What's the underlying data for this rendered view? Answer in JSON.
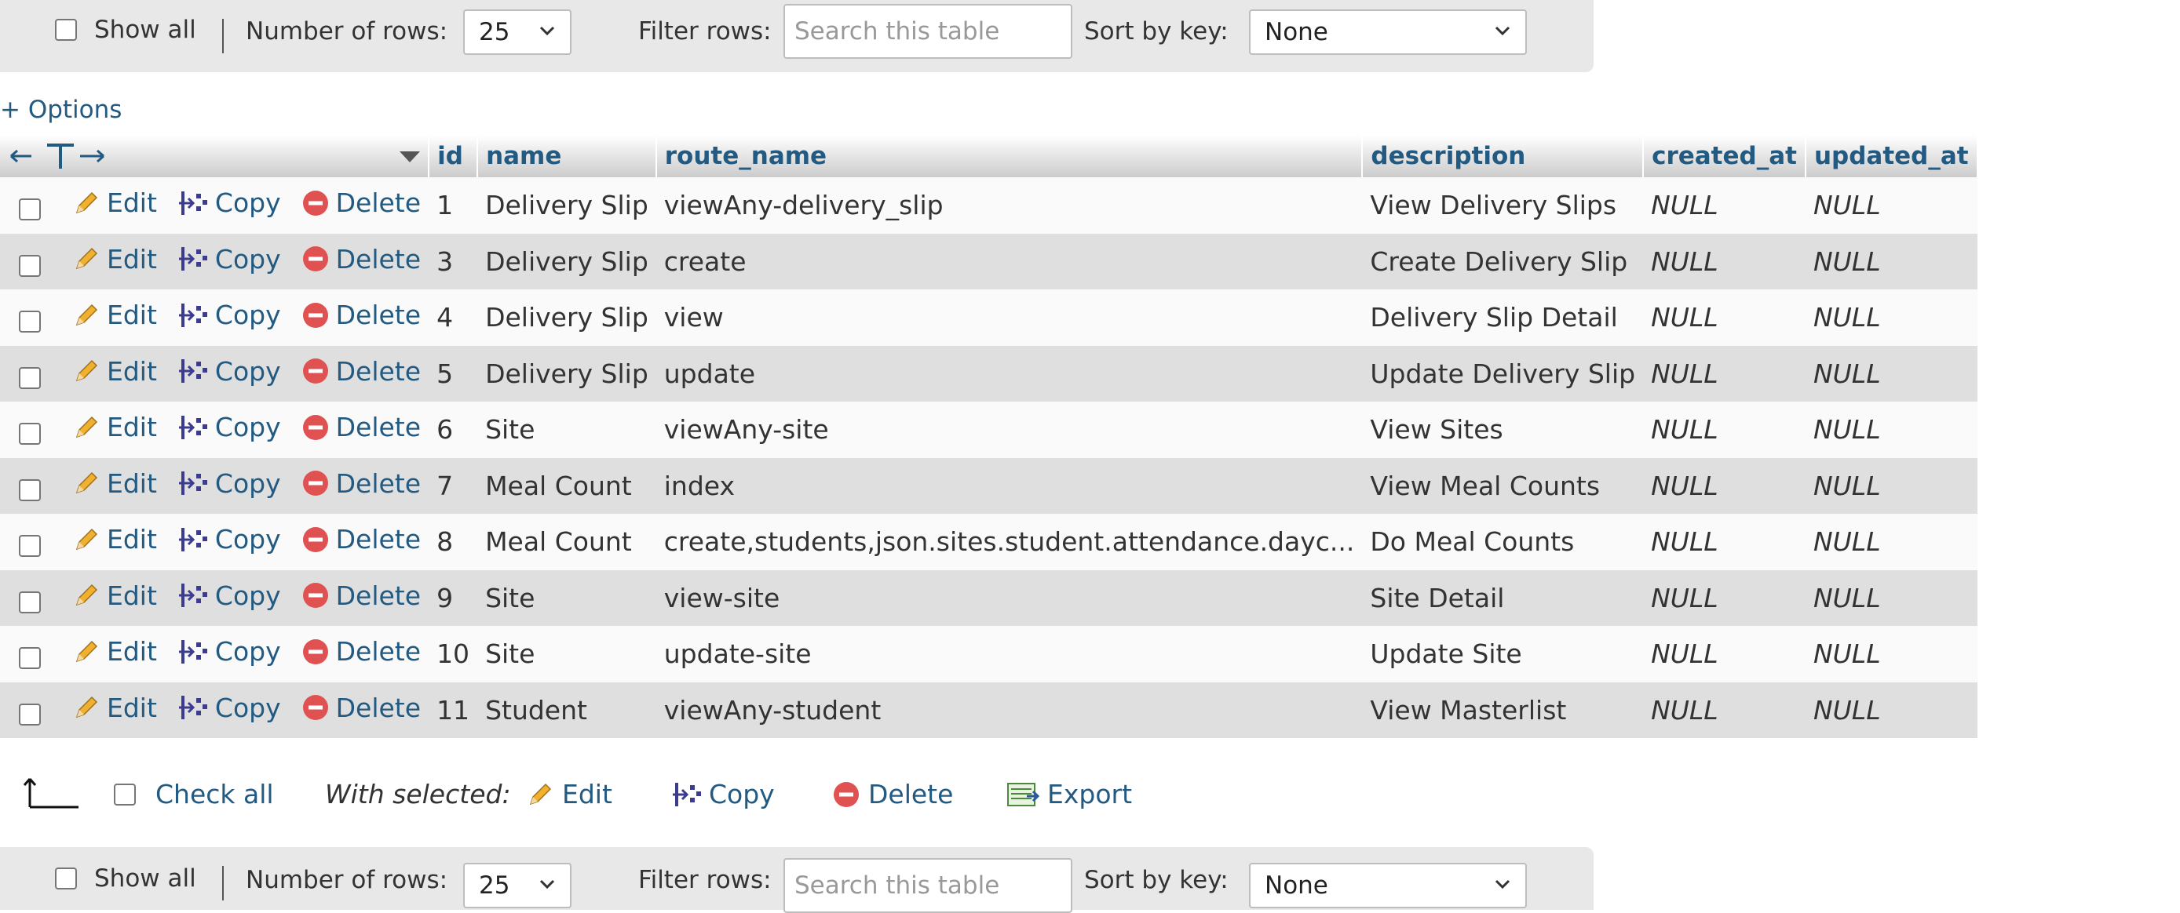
{
  "top_bar": {
    "show_all_label": "Show all",
    "rows_label": "Number of rows:",
    "rows_value": "25",
    "filter_label": "Filter rows:",
    "filter_placeholder": "Search this table",
    "sort_label": "Sort by key:",
    "sort_value": "None"
  },
  "options_label": "+ Options",
  "columns": [
    "id",
    "name",
    "route_name",
    "description",
    "created_at",
    "updated_at"
  ],
  "row_actions": {
    "edit": "Edit",
    "copy": "Copy",
    "delete": "Delete"
  },
  "rows": [
    {
      "id": "1",
      "name": "Delivery Slip",
      "route_name": "viewAny-delivery_slip",
      "description": "View Delivery Slips",
      "created_at": "NULL",
      "updated_at": "NULL"
    },
    {
      "id": "3",
      "name": "Delivery Slip",
      "route_name": "create",
      "description": "Create Delivery Slip",
      "created_at": "NULL",
      "updated_at": "NULL"
    },
    {
      "id": "4",
      "name": "Delivery Slip",
      "route_name": "view",
      "description": "Delivery Slip Detail",
      "created_at": "NULL",
      "updated_at": "NULL"
    },
    {
      "id": "5",
      "name": "Delivery Slip",
      "route_name": "update",
      "description": "Update Delivery Slip",
      "created_at": "NULL",
      "updated_at": "NULL"
    },
    {
      "id": "6",
      "name": "Site",
      "route_name": "viewAny-site",
      "description": "View Sites",
      "created_at": "NULL",
      "updated_at": "NULL"
    },
    {
      "id": "7",
      "name": "Meal Count",
      "route_name": "index",
      "description": "View Meal Counts",
      "created_at": "NULL",
      "updated_at": "NULL"
    },
    {
      "id": "8",
      "name": "Meal Count",
      "route_name": "create,students,json.sites.student.attendance.dayc...",
      "description": "Do Meal Counts",
      "created_at": "NULL",
      "updated_at": "NULL"
    },
    {
      "id": "9",
      "name": "Site",
      "route_name": "view-site",
      "description": "Site Detail",
      "created_at": "NULL",
      "updated_at": "NULL"
    },
    {
      "id": "10",
      "name": "Site",
      "route_name": "update-site",
      "description": "Update Site",
      "created_at": "NULL",
      "updated_at": "NULL"
    },
    {
      "id": "11",
      "name": "Student",
      "route_name": "viewAny-student",
      "description": "View Masterlist",
      "created_at": "NULL",
      "updated_at": "NULL"
    }
  ],
  "bulk": {
    "check_all": "Check all",
    "with_selected": "With selected:",
    "edit": "Edit",
    "copy": "Copy",
    "delete": "Delete",
    "export": "Export"
  },
  "bottom_bar": {
    "show_all_label": "Show all",
    "rows_label": "Number of rows:",
    "rows_value": "25",
    "filter_label": "Filter rows:",
    "filter_placeholder": "Search this table",
    "sort_label": "Sort by key:",
    "sort_value": "None"
  },
  "colors": {
    "link": "#235a81",
    "row_odd": "#fafafa",
    "row_even": "#dfdfdf",
    "bar": "#e8e8e8",
    "delete_red": "#e05252"
  }
}
